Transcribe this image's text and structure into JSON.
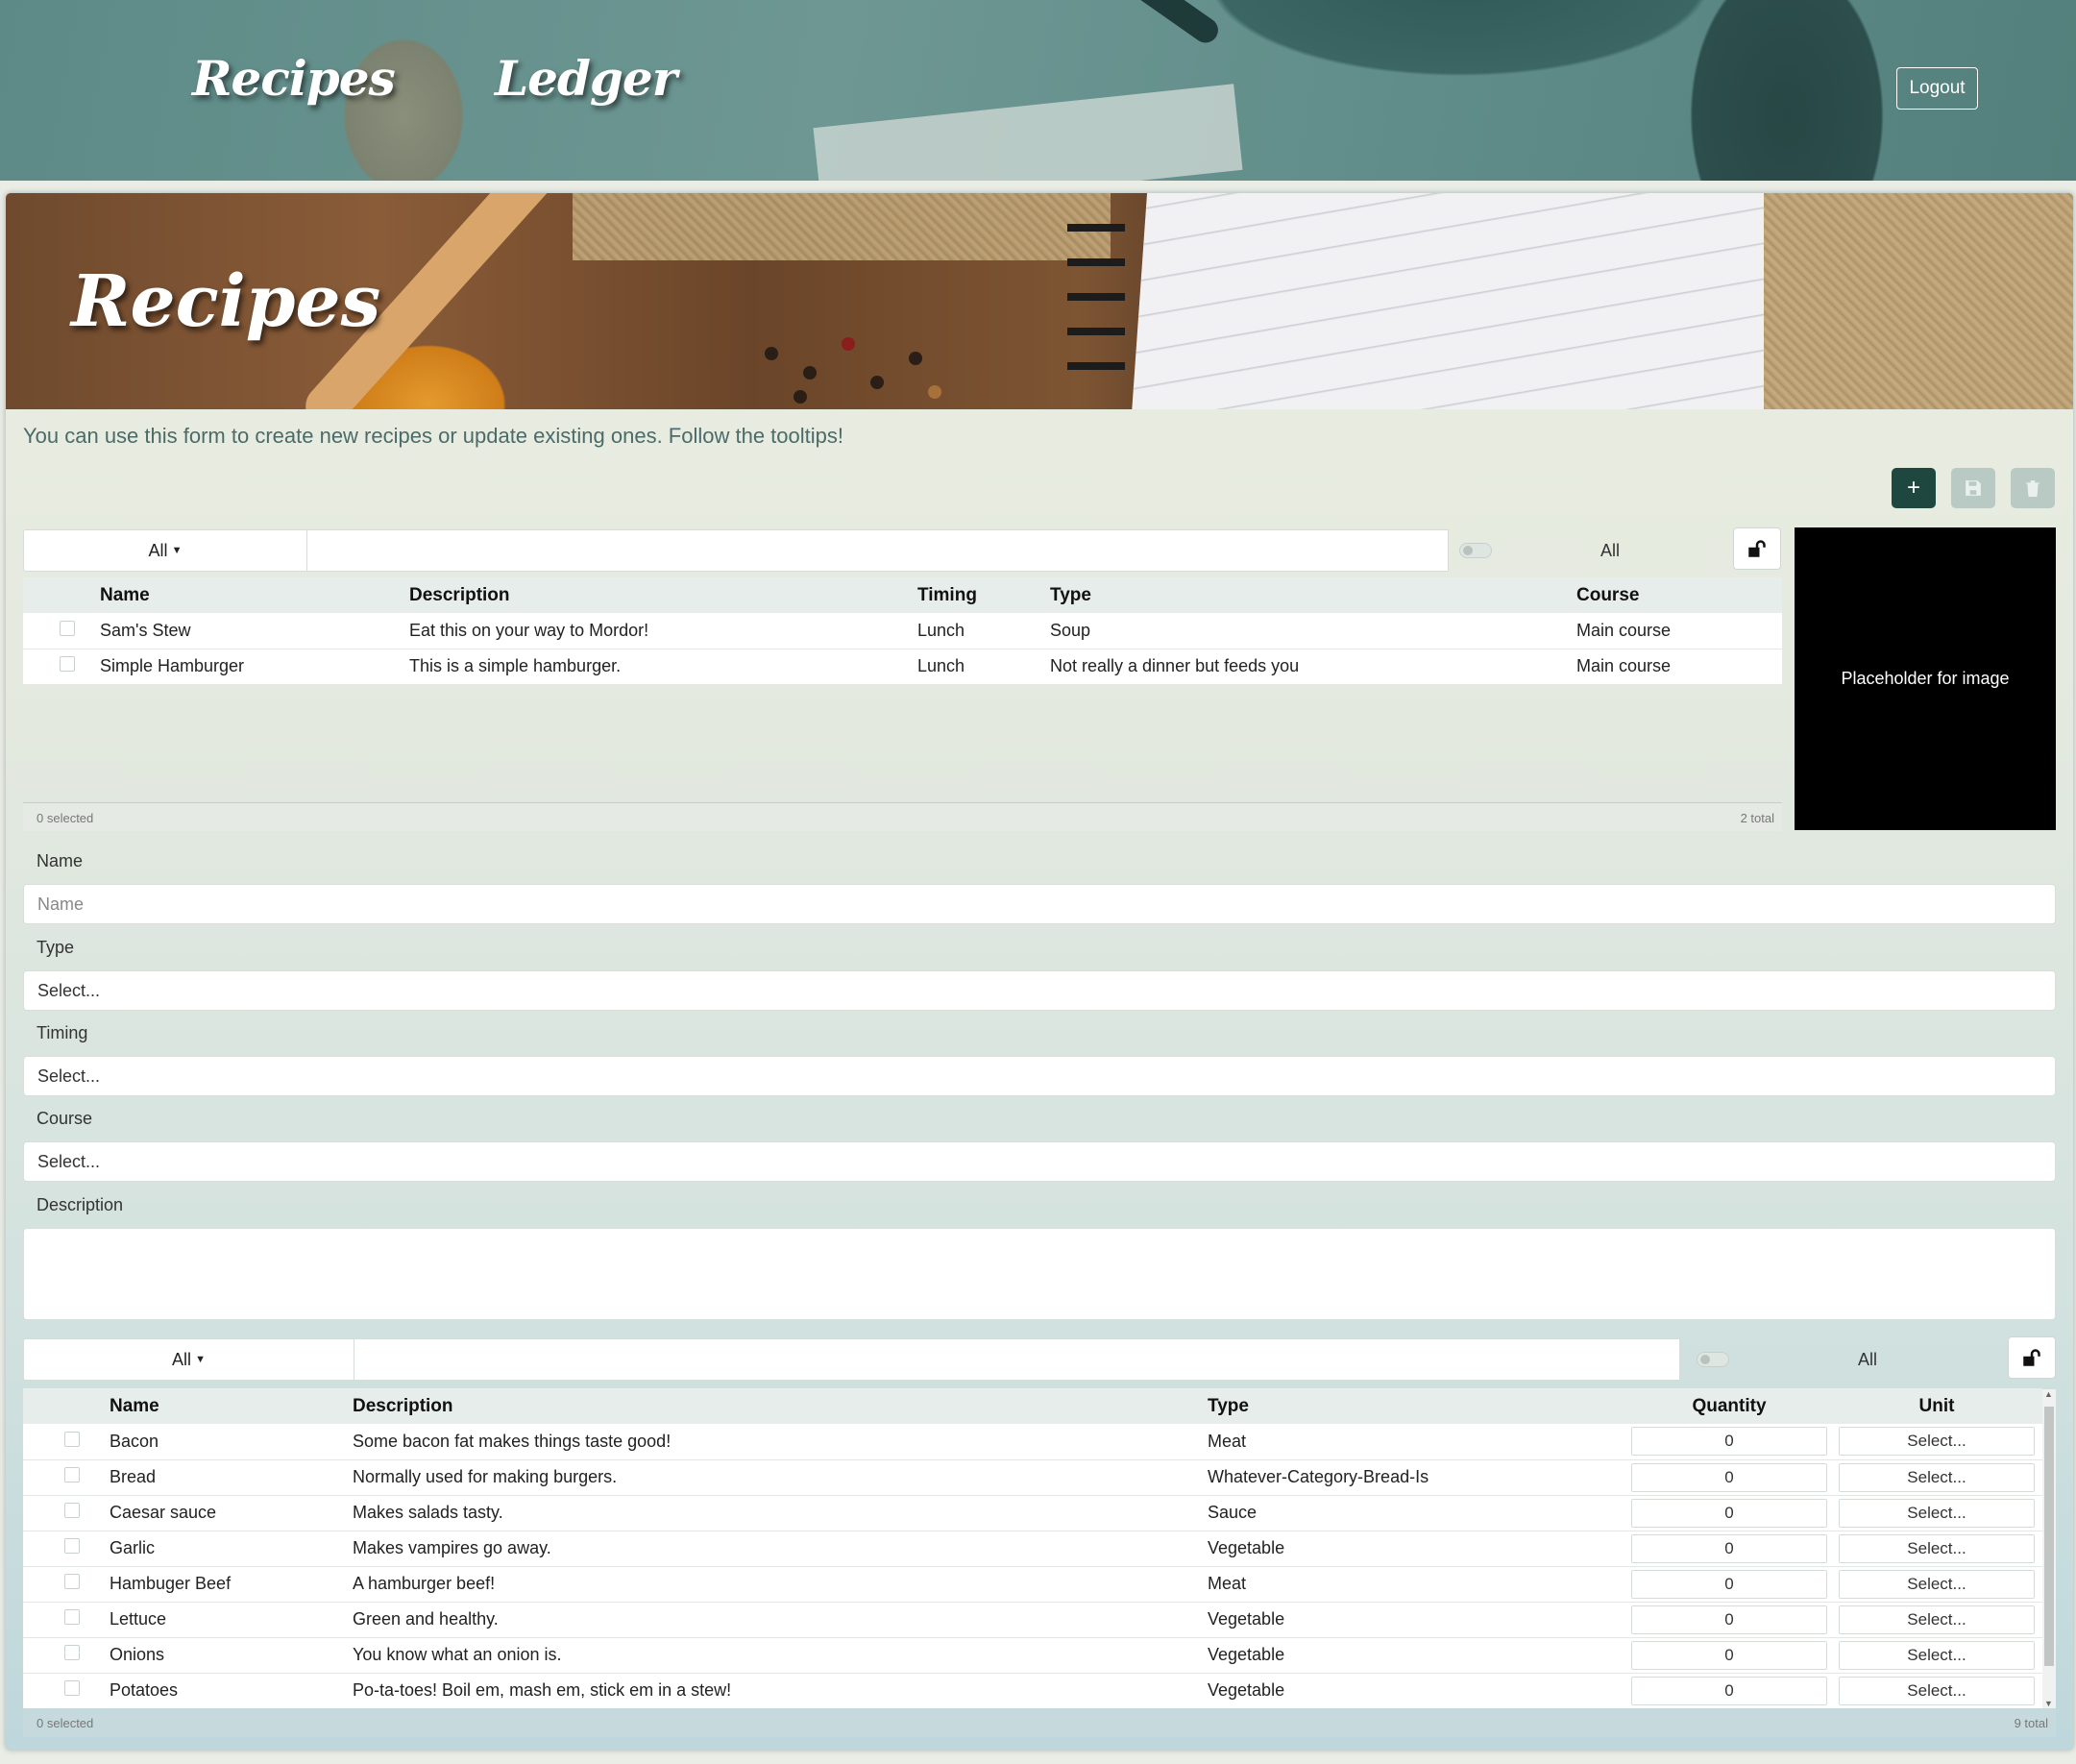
{
  "nav": {
    "recipes_label": "Recipes",
    "ledger_label": "Ledger",
    "logout_label": "Logout"
  },
  "banner": {
    "title": "Recipes"
  },
  "intro": "You can use this form to create new recipes or update existing ones. Follow the tooltips!",
  "actions": {
    "add_icon": "+",
    "save_icon": "save-icon",
    "delete_icon": "trash-icon"
  },
  "recipes_filter": {
    "dropdown_value": "All",
    "toggle_label": "All"
  },
  "recipes_table": {
    "columns": [
      "Name",
      "Description",
      "Timing",
      "Type",
      "Course"
    ],
    "rows": [
      {
        "name": "Sam's Stew",
        "description": "Eat this on your way to Mordor!",
        "timing": "Lunch",
        "type": "Soup",
        "course": "Main course"
      },
      {
        "name": "Simple Hamburger",
        "description": "This is a simple hamburger.",
        "timing": "Lunch",
        "type": "Not really a dinner but feeds you",
        "course": "Main course"
      }
    ],
    "selected": "0 selected",
    "total": "2 total"
  },
  "image_placeholder": "Placeholder for image",
  "form": {
    "name_label": "Name",
    "name_placeholder": "Name",
    "type_label": "Type",
    "type_value": "Select...",
    "timing_label": "Timing",
    "timing_value": "Select...",
    "course_label": "Course",
    "course_value": "Select...",
    "description_label": "Description"
  },
  "ingredients_filter": {
    "dropdown_value": "All",
    "toggle_label": "All"
  },
  "ingredients_table": {
    "columns": [
      "Name",
      "Description",
      "Type",
      "Quantity",
      "Unit"
    ],
    "rows": [
      {
        "name": "Bacon",
        "description": "Some bacon fat makes things taste good!",
        "type": "Meat",
        "quantity": "0",
        "unit": "Select..."
      },
      {
        "name": "Bread",
        "description": "Normally used for making burgers.",
        "type": "Whatever-Category-Bread-Is",
        "quantity": "0",
        "unit": "Select..."
      },
      {
        "name": "Caesar sauce",
        "description": "Makes salads tasty.",
        "type": "Sauce",
        "quantity": "0",
        "unit": "Select..."
      },
      {
        "name": "Garlic",
        "description": "Makes vampires go away.",
        "type": "Vegetable",
        "quantity": "0",
        "unit": "Select..."
      },
      {
        "name": "Hambuger Beef",
        "description": "A hamburger beef!",
        "type": "Meat",
        "quantity": "0",
        "unit": "Select..."
      },
      {
        "name": "Lettuce",
        "description": "Green and healthy.",
        "type": "Vegetable",
        "quantity": "0",
        "unit": "Select..."
      },
      {
        "name": "Onions",
        "description": "You know what an onion is.",
        "type": "Vegetable",
        "quantity": "0",
        "unit": "Select..."
      },
      {
        "name": "Potatoes",
        "description": "Po-ta-toes! Boil em, mash em, stick em in a stew!",
        "type": "Vegetable",
        "quantity": "0",
        "unit": "Select..."
      }
    ],
    "selected": "0 selected",
    "total": "9 total"
  }
}
